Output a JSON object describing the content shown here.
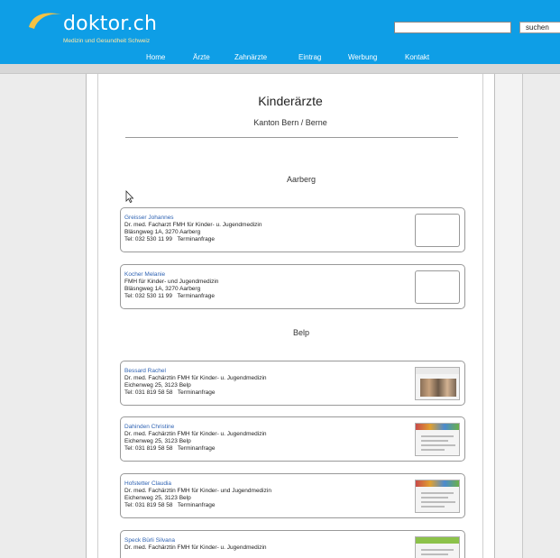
{
  "header": {
    "logo_text": "doktor.ch",
    "logo_subtitle": "Medizin und Gesundheit Schweiz",
    "search_placeholder": "",
    "search_button": "suchen",
    "nav": [
      "Home",
      "Ärzte",
      "Zahnärzte",
      "Eintrag",
      "Werbung",
      "Kontakt"
    ],
    "colors": {
      "header_bg": "#0e9ee6",
      "subtitle": "#ffe8a6"
    }
  },
  "page": {
    "title": "Kinderärzte",
    "subtitle": "Kanton Bern / Berne"
  },
  "sections": [
    {
      "heading": "Aarberg",
      "doctors": [
        {
          "name": "Greisser Johannes",
          "title": "Dr. med. Facharzt FMH für Kinder- u. Jugendmedizin",
          "address": "Bläsngweg 1A, 3270 Aarberg",
          "phone": "Tel: 032 530 11 99",
          "appointment": "Terminanfrage",
          "thumbnail": "empty"
        },
        {
          "name": "Kocher Melanie",
          "title": "FMH für Kinder- und Jugendmedizin",
          "address": "Bläsngweg 1A, 3270 Aarberg",
          "phone": "Tel: 032 530 11 99",
          "appointment": "Terminanfrage",
          "thumbnail": "empty"
        }
      ]
    },
    {
      "heading": "Belp",
      "doctors": [
        {
          "name": "Bessard Rachel",
          "title": "Dr. med. Fachärztin FMH für Kinder- u. Jugendmedizin",
          "address": "Eichenweg 25, 3123 Belp",
          "phone": "Tel: 031 819 58 58",
          "appointment": "Terminanfrage",
          "thumbnail": "website-photo"
        },
        {
          "name": "Dahinden Christine",
          "title": "Dr. med. Fachärztin FMH für Kinder- u. Jugendmedizin",
          "address": "Eichenweg 25, 3123 Belp",
          "phone": "Tel: 031 819 58 58",
          "appointment": "Terminanfrage",
          "thumbnail": "website"
        },
        {
          "name": "Hofstetter Claudia",
          "title": "Dr. med. Fachärztin FMH für Kinder- und Jugendmedizin",
          "address": "Eichenweg 25, 3123 Belp",
          "phone": "Tel: 031 819 58 58",
          "appointment": "Terminanfrage",
          "thumbnail": "website"
        },
        {
          "name": "Speck Bürli Silvana",
          "title": "Dr. med. Fachärztin FMH für Kinder- u. Jugendmedizin",
          "address": "",
          "phone": "",
          "appointment": "",
          "thumbnail": "website-green"
        }
      ]
    }
  ]
}
